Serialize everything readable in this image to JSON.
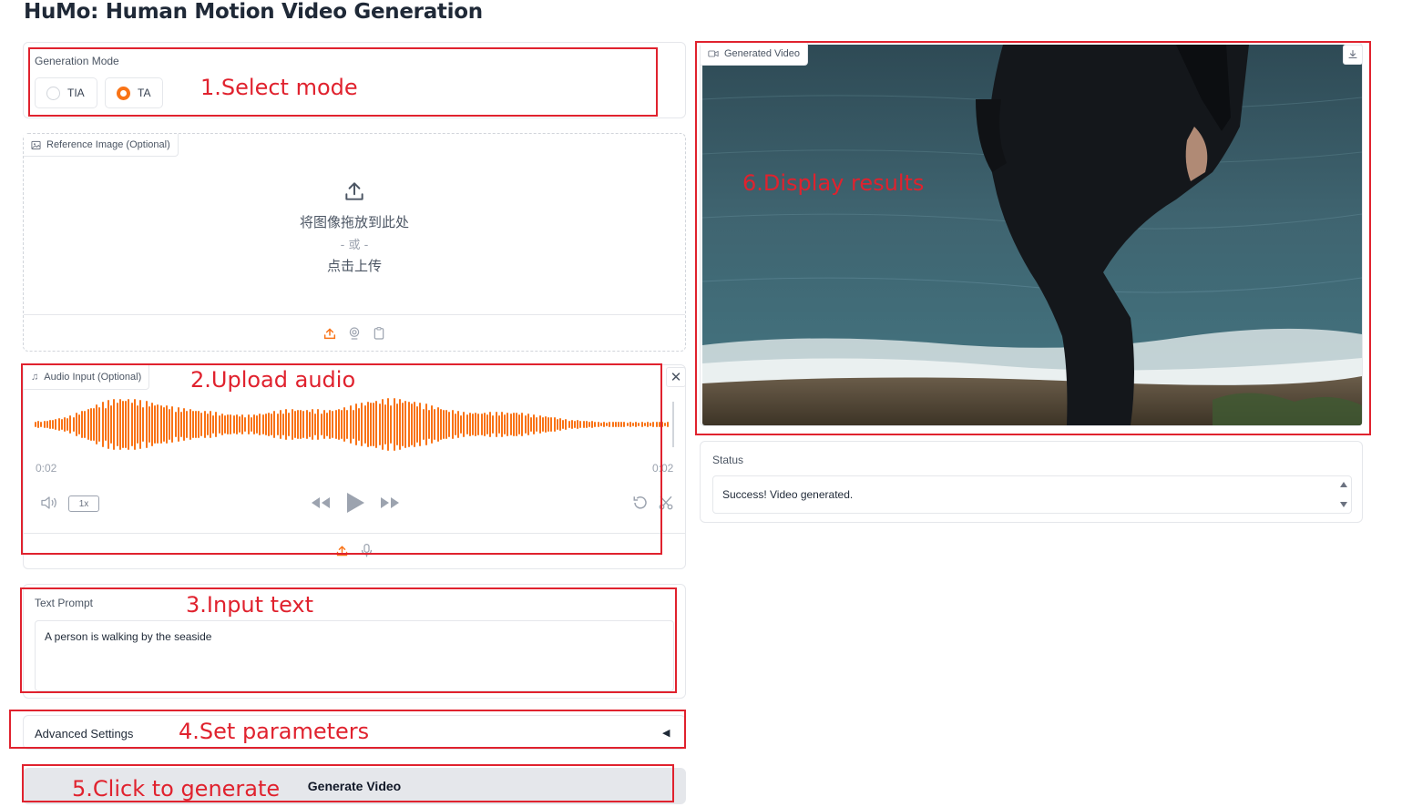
{
  "app": {
    "title": "HuMo: Human Motion Video Generation"
  },
  "generation_mode": {
    "label": "Generation Mode",
    "options": [
      {
        "label": "TIA",
        "selected": false
      },
      {
        "label": "TA",
        "selected": true
      }
    ]
  },
  "reference_image": {
    "label": "Reference Image (Optional)",
    "drop_text": "将图像拖放到此处",
    "or_text": "- 或 -",
    "click_text": "点击上传"
  },
  "audio_input": {
    "label": "Audio Input (Optional)",
    "time_start": "0:02",
    "time_end": "0:02",
    "speed": "1x"
  },
  "text_prompt": {
    "label": "Text Prompt",
    "value": "A person is walking by the seaside"
  },
  "advanced_settings": {
    "label": "Advanced Settings",
    "arrow": "◀"
  },
  "generate": {
    "label": "Generate Video"
  },
  "generated_video": {
    "label": "Generated Video"
  },
  "status": {
    "label": "Status",
    "value": "Success! Video generated."
  },
  "annotations": {
    "step1": "1.Select mode",
    "step2": "2.Upload audio",
    "step3": "3.Input text",
    "step4": "4.Set parameters",
    "step5": "5.Click to generate",
    "step6": "6.Display results"
  },
  "colors": {
    "accent": "#f97316",
    "annotation": "#e0222e",
    "border": "#e5e7eb"
  },
  "icons": [
    "image-icon",
    "upload-icon",
    "webcam-icon",
    "clipboard-icon",
    "music-icon",
    "close-icon",
    "volume-icon",
    "rewind-icon",
    "play-icon",
    "forward-icon",
    "undo-icon",
    "scissors-icon",
    "mic-icon",
    "video-icon",
    "download-icon"
  ]
}
